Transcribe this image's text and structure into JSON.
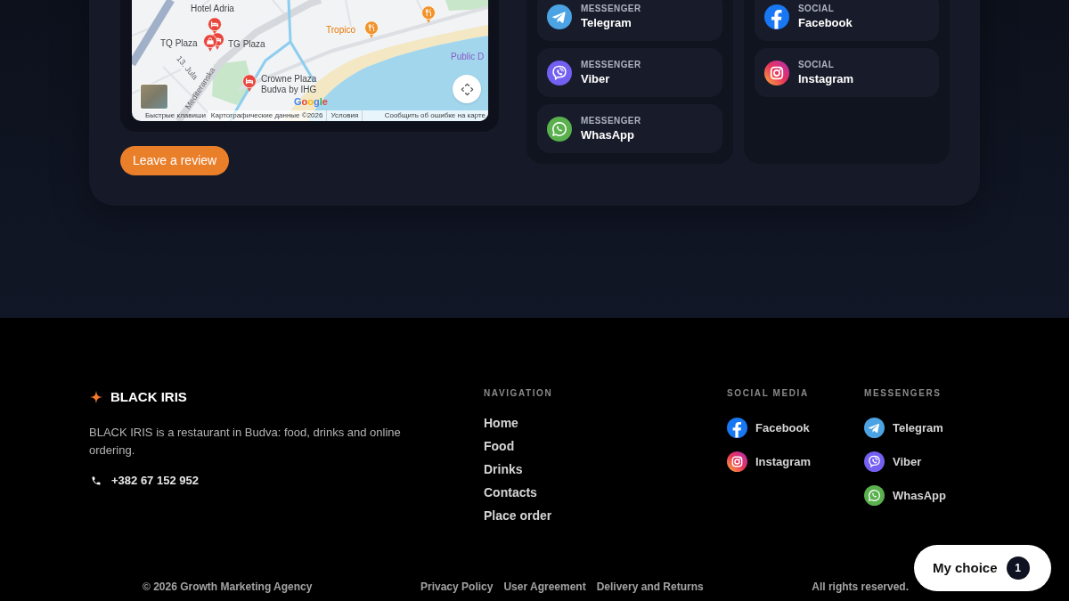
{
  "location": {
    "map": {
      "places": [
        {
          "kind": "hotel",
          "label": "Hotel Adria"
        },
        {
          "kind": "shop",
          "label": "TQ Plaza"
        },
        {
          "kind": "hotel",
          "label": "TG Plaza"
        },
        {
          "kind": "restaurant",
          "label": "Tropico"
        },
        {
          "kind": "restaurant"
        },
        {
          "kind": "hotel",
          "label": "Crowne Plaza Budva by IHG"
        }
      ],
      "streets": [
        "13. Jula",
        "Mediteranska"
      ],
      "water_label": "Public D",
      "logo": "Google",
      "attribution": [
        "Быстрые клавиши",
        "Картографические данные ©2026",
        "Условия",
        "Сообщить об ошибке на карте"
      ]
    },
    "review_button": "Leave a review"
  },
  "contact_panels": [
    {
      "items": [
        {
          "kind": "telegram",
          "category": "MESSENGER",
          "name": "Telegram"
        },
        {
          "kind": "viber",
          "category": "MESSENGER",
          "name": "Viber"
        },
        {
          "kind": "whatsapp",
          "category": "MESSENGER",
          "name": "WhasApp"
        }
      ]
    },
    {
      "items": [
        {
          "kind": "facebook",
          "category": "SOCIAL",
          "name": "Facebook"
        },
        {
          "kind": "instagram",
          "category": "SOCIAL",
          "name": "Instagram"
        }
      ]
    }
  ],
  "footer": {
    "brand": "BLACK IRIS",
    "description": "BLACK IRIS is a restaurant in Budva: food, drinks and online ordering.",
    "phone": "+382 67 152 952",
    "navigation": {
      "title": "NAVIGATION",
      "links": [
        "Home",
        "Food",
        "Drinks",
        "Contacts",
        "Place order"
      ]
    },
    "social": {
      "title": "SOCIAL MEDIA",
      "links": [
        {
          "kind": "facebook",
          "label": "Facebook"
        },
        {
          "kind": "instagram",
          "label": "Instagram"
        }
      ]
    },
    "messengers": {
      "title": "MESSENGERS",
      "links": [
        {
          "kind": "telegram",
          "label": "Telegram"
        },
        {
          "kind": "viber",
          "label": "Viber"
        },
        {
          "kind": "whatsapp",
          "label": "WhasApp"
        }
      ]
    },
    "bottom": {
      "copyright": "© 2026 Growth Marketing Agency",
      "links": [
        "Privacy Policy",
        "User Agreement",
        "Delivery and Returns"
      ],
      "rights": "All rights reserved."
    }
  },
  "floating_button": {
    "label": "My choice",
    "count": "1"
  }
}
